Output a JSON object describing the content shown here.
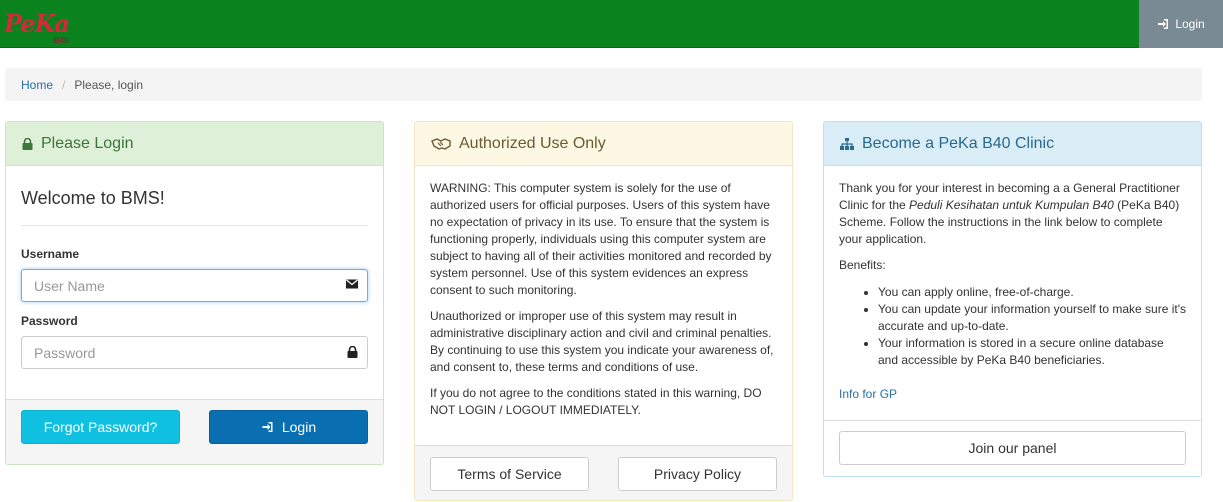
{
  "navbar": {
    "brand_text": "PeKa",
    "brand_sub": "B40",
    "login_label": "Login",
    "bg_color": "#0a831f"
  },
  "breadcrumb": {
    "home": "Home",
    "current": "Please, login"
  },
  "login_panel": {
    "heading": "Please Login",
    "welcome": "Welcome to BMS!",
    "username_label": "Username",
    "username_placeholder": "User Name",
    "username_value": "",
    "password_label": "Password",
    "password_placeholder": "Password",
    "password_value": "",
    "forgot_label": "Forgot Password?",
    "login_label": "Login"
  },
  "auth_panel": {
    "heading": "Authorized Use Only",
    "para1": "WARNING: This computer system is solely for the use of authorized users for official purposes. Users of this system have no expectation of privacy in its use. To ensure that the system is functioning properly, individuals using this computer system are subject to having all of their activities monitored and recorded by system personnel. Use of this system evidences an express consent to such monitoring.",
    "para2": "Unauthorized or improper use of this system may result in administrative disciplinary action and civil and criminal penalties. By continuing to use this system you indicate your awareness of, and consent to, these terms and conditions of use.",
    "para3": "If you do not agree to the conditions stated in this warning, DO NOT LOGIN / LOGOUT IMMEDIATELY.",
    "terms_label": "Terms of Service",
    "privacy_label": "Privacy Policy"
  },
  "clinic_panel": {
    "heading": "Become a PeKa B40 Clinic",
    "intro_a": "Thank you for your interest in becoming a a General Practitioner Clinic for the ",
    "intro_em": "Peduli Kesihatan untuk Kumpulan B40",
    "intro_b": " (PeKa B40) Scheme. Follow the instructions in the link below to complete your application.",
    "benefits_label": "Benefits:",
    "benefits": [
      "You can apply online, free-of-charge.",
      "You can update your information yourself to make sure it's accurate and up-to-date.",
      "Your information is stored in a secure online database and accessible by PeKa B40 beneficiaries."
    ],
    "info_link": "Info for GP",
    "join_label": "Join our panel"
  }
}
